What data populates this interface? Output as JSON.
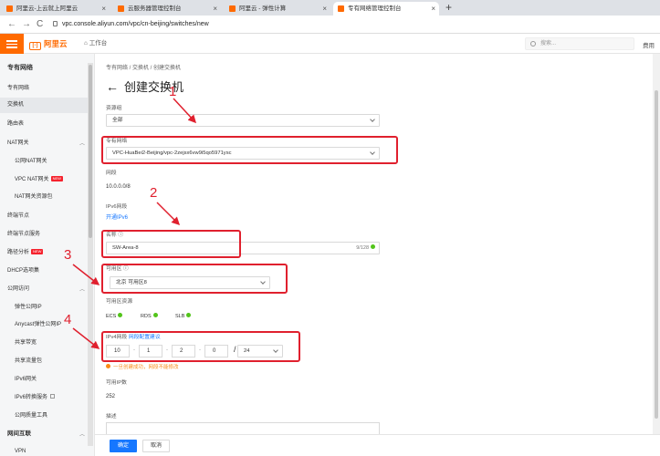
{
  "browser": {
    "tabs": [
      {
        "label": "阿里云-上云就上阿里云"
      },
      {
        "label": "云服务器管理控制台"
      },
      {
        "label": "阿里云 - 弹性计算"
      },
      {
        "label": "专有网络管理控制台"
      }
    ],
    "new_tab": "+",
    "url": "vpc.console.aliyun.com/vpc/cn-beijing/switches/new",
    "nav": {
      "back": "←",
      "forward": "→",
      "reload": "C"
    }
  },
  "topbar": {
    "logo_text": "阿里云",
    "workbench": "工作台",
    "search_placeholder": "搜索...",
    "fee": "费用"
  },
  "sidebar": {
    "title": "专有网络",
    "items": [
      {
        "label": "专有网络"
      },
      {
        "label": "交换机"
      },
      {
        "label": "路由表"
      },
      {
        "label": "NAT网关"
      },
      {
        "label": "公网NAT网关"
      },
      {
        "label": "VPC NAT网关",
        "badge": "NEW"
      },
      {
        "label": "NAT网关资源包"
      },
      {
        "label": "终端节点"
      },
      {
        "label": "终端节点服务"
      },
      {
        "label": "路径分析",
        "badge": "NEW"
      },
      {
        "label": "DHCP选项集"
      },
      {
        "label": "公网访问"
      },
      {
        "label": "弹性公网IP"
      },
      {
        "label": "Anycast弹性公网IP"
      },
      {
        "label": "共享带宽"
      },
      {
        "label": "共享流量包"
      },
      {
        "label": "IPv6网关"
      },
      {
        "label": "IPv6转换服务"
      },
      {
        "label": "公网质量工具"
      },
      {
        "label": "网间互联"
      },
      {
        "label": "VPN"
      }
    ]
  },
  "main": {
    "breadcrumb": "专有网络  /  交换机  /  创建交换机",
    "title": "创建交换机",
    "back_arrow": "←",
    "resource_group": {
      "label": "资源组",
      "value": "全部"
    },
    "vpc": {
      "label": "专有网络",
      "value": "VPC-HuaBei2-Beijing/vpc-2zejsx6vw9i5qo5971ysc"
    },
    "cidr": {
      "label": "网段",
      "value": "10.0.0.0/8"
    },
    "ipv6": {
      "label": "IPv6网段",
      "link": "开通IPv6"
    },
    "name": {
      "label": "名称",
      "value": "SW-Area-8",
      "count": "9/128"
    },
    "zone": {
      "label": "可用区",
      "value": "北京 可用区8"
    },
    "zone_resources": {
      "label": "可用区资源",
      "items": [
        "ECS",
        "RDS",
        "SLB"
      ]
    },
    "ipv4": {
      "label": "IPv4网段",
      "link": "网段配置建议",
      "octets": [
        "10",
        "1",
        "2",
        "0"
      ],
      "mask": "24",
      "warning": "一旦创建成功，网段不能修改"
    },
    "available_ip": {
      "label": "可用IP数",
      "value": "252"
    },
    "description": {
      "label": "描述"
    }
  },
  "footer": {
    "confirm": "确定",
    "cancel": "取消"
  },
  "annotations": [
    "1",
    "2",
    "3",
    "4"
  ],
  "colors": {
    "accent": "#ff6a00",
    "annotation": "#e0202e",
    "primary": "#1677ff"
  }
}
